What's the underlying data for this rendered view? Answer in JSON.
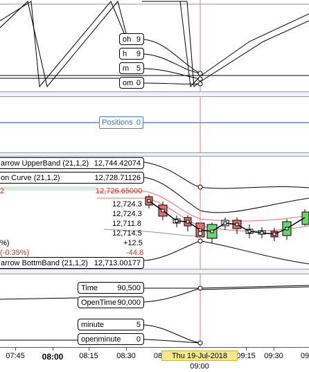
{
  "top_pane": {
    "labels": [
      {
        "key": "oh",
        "value": "9"
      },
      {
        "key": "h",
        "value": "9"
      },
      {
        "key": "m",
        "value": "5"
      },
      {
        "key": "om",
        "value": "0"
      }
    ]
  },
  "positions": {
    "label": "Positions",
    "value": "0"
  },
  "price_pane": {
    "upper_band": {
      "label": "arrow UpperBand (21,1,2)",
      "value": "12,744.42074"
    },
    "curve": {
      "label": "on Curve (21,1,2)",
      "value": "12,728.71126"
    },
    "red_line": {
      "label": "2",
      "value": "12,726.65000"
    },
    "ohlc": [
      "12,724.3",
      "12,724.3",
      "12,711.8",
      "12,714.5"
    ],
    "change": "+12.5",
    "pct_label": "%)",
    "change2_label": "(-0.35%)",
    "change2": "-44.8",
    "bottom_band": {
      "label": "arrow BottmBand (21,1,2)",
      "value": "12,713.00177"
    }
  },
  "time_pane": {
    "labels": [
      {
        "key": "Time",
        "value": "90,500"
      },
      {
        "key": "OpenTime",
        "value": "90,000"
      },
      {
        "key": "minute",
        "value": "5"
      },
      {
        "key": "openminute",
        "value": "0"
      }
    ]
  },
  "x_axis": {
    "ticks": [
      "07:45",
      "08:00",
      "08:15",
      "08:30",
      "08",
      "09:15",
      "09:30",
      "09:45",
      "09"
    ],
    "cursor_date": "Thu 19-Jul-2018 09:00"
  },
  "colors": {
    "cursor_line": "#e07a7a",
    "positions_line": "#1f3fbf",
    "up_candle": "#6cd46c",
    "down_candle": "#e07070",
    "band_red": "#e07070"
  }
}
